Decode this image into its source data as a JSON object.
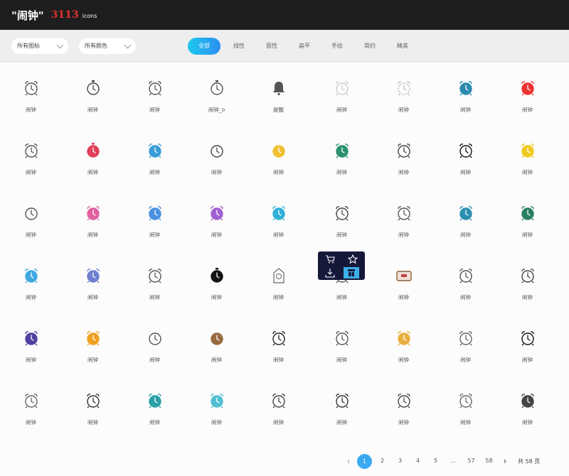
{
  "header": {
    "title": "\"闹钟\"",
    "count": "3113",
    "unit": "icons"
  },
  "filters": {
    "library_select": "所有图标",
    "color_select": "所有颜色",
    "tabs": [
      "全部",
      "线性",
      "面性",
      "扁平",
      "手绘",
      "简约",
      "精美"
    ],
    "active_tab": 0
  },
  "icons": [
    {
      "label": "闹钟",
      "icon": "alarm-clock-line-icon",
      "color": "#555"
    },
    {
      "label": "闹钟",
      "icon": "stopwatch-line-icon",
      "color": "#444"
    },
    {
      "label": "闹钟",
      "icon": "alarm-clock-line-icon",
      "color": "#555"
    },
    {
      "label": "闹钟_o",
      "icon": "stopwatch-line-icon",
      "color": "#555"
    },
    {
      "label": "提醒",
      "icon": "bell-icon",
      "color": "#555"
    },
    {
      "label": "闹钟",
      "icon": "alarm-clock-line-icon",
      "color": "#ccc"
    },
    {
      "label": "闹钟",
      "icon": "alarm-clock-dashed-icon",
      "color": "#bbb"
    },
    {
      "label": "闹钟",
      "icon": "alarm-clock-badge-icon",
      "color": "#2a8ab0"
    },
    {
      "label": "闹钟",
      "icon": "alarm-clock-red-icon",
      "color": "#e33"
    },
    {
      "label": "闹钟",
      "icon": "alarm-clock-line-icon",
      "color": "#555"
    },
    {
      "label": "闹钟",
      "icon": "stopwatch-red-icon",
      "color": "#e0405a"
    },
    {
      "label": "闹钟",
      "icon": "alarm-clock-blue-icon",
      "color": "#3a9ed8"
    },
    {
      "label": "闹钟",
      "icon": "clock-line-icon",
      "color": "#444"
    },
    {
      "label": "闹钟",
      "icon": "clock-yellow-icon",
      "color": "#f0c030"
    },
    {
      "label": "闹钟",
      "icon": "alarm-clock-green-icon",
      "color": "#2a9070"
    },
    {
      "label": "闹钟",
      "icon": "alarm-clock-line-icon",
      "color": "#444"
    },
    {
      "label": "闹钟",
      "icon": "alarm-clock-line-icon",
      "color": "#111"
    },
    {
      "label": "闹钟",
      "icon": "alarm-clock-yellow-icon",
      "color": "#f0c820"
    },
    {
      "label": "闹钟",
      "icon": "clock-line-icon",
      "color": "#555"
    },
    {
      "label": "闹钟",
      "icon": "alarm-clock-pink-icon",
      "color": "#e060a0"
    },
    {
      "label": "闹钟",
      "icon": "alarm-clock-blue-icon",
      "color": "#4a90e0"
    },
    {
      "label": "闹钟",
      "icon": "alarm-clock-purple-icon",
      "color": "#a060d0"
    },
    {
      "label": "闹钟",
      "icon": "alarm-clock-cyan-icon",
      "color": "#30b0d8"
    },
    {
      "label": "闹钟",
      "icon": "alarm-clock-line-icon",
      "color": "#444"
    },
    {
      "label": "闹钟",
      "icon": "alarm-clock-line-icon",
      "color": "#555"
    },
    {
      "label": "闹钟",
      "icon": "alarm-clock-teal-icon",
      "color": "#2a90b0"
    },
    {
      "label": "闹钟",
      "icon": "alarm-clock-green-icon",
      "color": "#2a8060"
    },
    {
      "label": "闹钟",
      "icon": "alarm-clock-lightblue-icon",
      "color": "#40a8e0"
    },
    {
      "label": "闹钟",
      "icon": "alarm-clock-violet-icon",
      "color": "#7080d0"
    },
    {
      "label": "闹钟",
      "icon": "alarm-clock-line-icon",
      "color": "#555"
    },
    {
      "label": "闹钟",
      "icon": "stopwatch-black-icon",
      "color": "#111"
    },
    {
      "label": "闹钟",
      "icon": "cuckoo-clock-icon",
      "color": "#666"
    },
    {
      "label": "闹钟",
      "icon": "alarm-clock-line-icon",
      "color": "#555"
    },
    {
      "label": "闹钟",
      "icon": "digital-clock-icon",
      "color": "#8a6040"
    },
    {
      "label": "闹钟",
      "icon": "alarm-clock-line-icon",
      "color": "#555"
    },
    {
      "label": "闹钟",
      "icon": "alarm-clock-line-icon",
      "color": "#444"
    },
    {
      "label": "闹钟",
      "icon": "alarm-clock-purple-icon",
      "color": "#5040a0"
    },
    {
      "label": "闹钟",
      "icon": "alarm-clock-orange-icon",
      "color": "#f0a020"
    },
    {
      "label": "闹钟",
      "icon": "clock-line-icon",
      "color": "#555"
    },
    {
      "label": "闹钟",
      "icon": "clock-brown-icon",
      "color": "#9a6a40"
    },
    {
      "label": "闹钟",
      "icon": "alarm-clock-line-icon",
      "color": "#222"
    },
    {
      "label": "闹钟",
      "icon": "alarm-clock-line-icon",
      "color": "#555"
    },
    {
      "label": "闹钟",
      "icon": "alarm-clock-yellow-icon",
      "color": "#e8b040"
    },
    {
      "label": "闹钟",
      "icon": "alarm-clock-line-icon",
      "color": "#666"
    },
    {
      "label": "闹钟",
      "icon": "alarm-clock-line-icon",
      "color": "#111"
    },
    {
      "label": "闹钟",
      "icon": "alarm-clock-line-icon",
      "color": "#666"
    },
    {
      "label": "闹钟",
      "icon": "alarm-clock-line-icon",
      "color": "#333"
    },
    {
      "label": "闹钟",
      "icon": "alarm-clock-teal-icon",
      "color": "#2aa0a8"
    },
    {
      "label": "闹钟",
      "icon": "alarm-clock-cyan-icon",
      "color": "#50c0d0"
    },
    {
      "label": "闹钟",
      "icon": "alarm-clock-line-icon",
      "color": "#444"
    },
    {
      "label": "闹钟",
      "icon": "alarm-clock-line-icon",
      "color": "#333"
    },
    {
      "label": "闹钟",
      "icon": "alarm-clock-line-icon",
      "color": "#444"
    },
    {
      "label": "闹钟",
      "icon": "alarm-clock-line-icon",
      "color": "#666"
    },
    {
      "label": "闹钟",
      "icon": "alarm-clock-orange-icon",
      "color": "#444"
    }
  ],
  "hover_overlay": {
    "actions": [
      "cart-icon",
      "star-icon",
      "download-icon",
      "copy-icon"
    ]
  },
  "pager": {
    "prev": "‹",
    "pages": [
      "1",
      "2",
      "3",
      "4",
      "5",
      "...",
      "57",
      "58"
    ],
    "current": "1",
    "next": "›",
    "total": "共 58 页"
  }
}
